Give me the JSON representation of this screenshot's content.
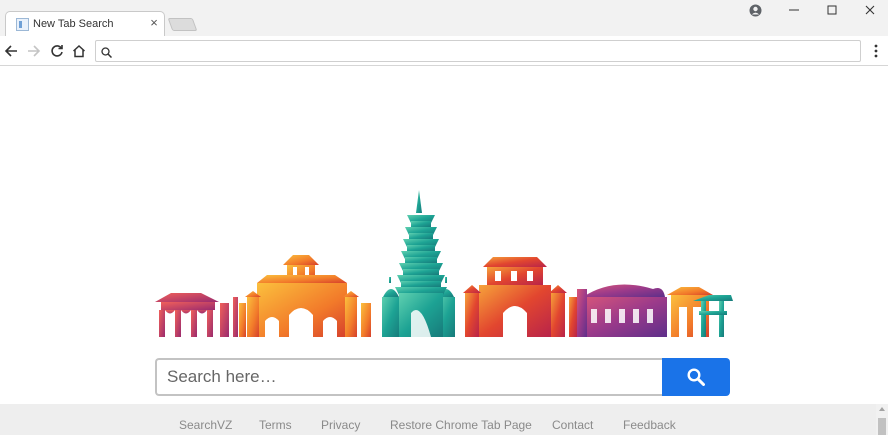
{
  "browser": {
    "tab": {
      "title": "New Tab Search",
      "close_glyph": "×",
      "favicon": "page-icon"
    },
    "new_tab_icon": "new-tab-icon",
    "window_controls": [
      "account-icon",
      "minimize-icon",
      "maximize-icon",
      "close-icon"
    ],
    "toolbar": {
      "icons": [
        "back-arrow-icon",
        "forward-arrow-icon",
        "reload-icon",
        "home-icon",
        "menu-kebab-icon"
      ],
      "omnibox": {
        "icon": "search-icon",
        "value": "",
        "placeholder": ""
      }
    }
  },
  "page": {
    "hero_image": "colorful-city-skyline-illustration",
    "search": {
      "placeholder": "Search here…",
      "value": "",
      "button_icon": "search-icon"
    },
    "footer_links": [
      "SearchVZ",
      "Terms",
      "Privacy",
      "Restore Chrome Tab Page",
      "Contact",
      "Feedback"
    ]
  },
  "colors": {
    "accent": "#1a73e8",
    "footer_bg": "#eeeeee",
    "footer_text": "#8a8a8a",
    "tabstrip_bg": "#f2f2f2"
  }
}
